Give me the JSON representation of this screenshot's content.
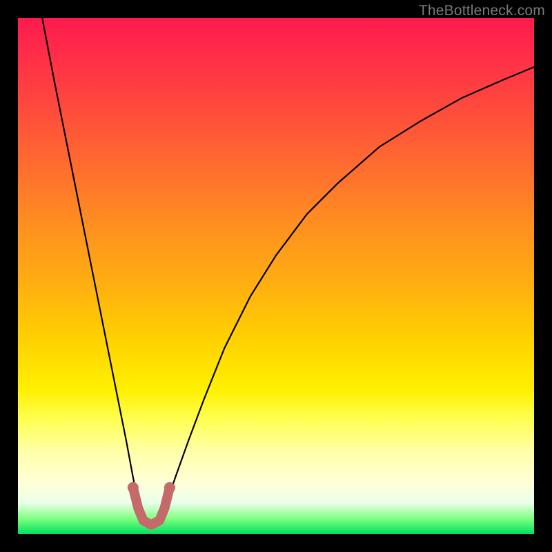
{
  "watermark": "TheBottleneck.com",
  "colors": {
    "bg_outer": "#000000",
    "gradient_top": "#ff1a4d",
    "gradient_bottom": "#00e060",
    "curve": "#000000",
    "nub": "#c46a6a",
    "watermark": "#7a7a7a"
  },
  "chart_data": {
    "type": "line",
    "title": "",
    "xlabel": "",
    "ylabel": "",
    "xlim": [
      0,
      100
    ],
    "ylim": [
      0,
      100
    ],
    "grid": false,
    "legend": false,
    "series": [
      {
        "name": "left-branch",
        "x": [
          4.7,
          7,
          9,
          11,
          13,
          15,
          17,
          19,
          21,
          22.3,
          23.3,
          24.3
        ],
        "y": [
          100,
          88,
          78,
          68,
          58,
          48,
          38,
          28,
          18,
          11,
          6,
          2.6
        ]
      },
      {
        "name": "right-branch",
        "x": [
          27.4,
          28.8,
          30.5,
          33,
          36,
          40,
          45,
          50,
          56,
          62,
          70,
          78,
          86,
          94,
          100
        ],
        "y": [
          2.6,
          6,
          11,
          18,
          26,
          36,
          46,
          54,
          62,
          68,
          75,
          80,
          84.5,
          88,
          90.5
        ]
      },
      {
        "name": "valley-u",
        "x": [
          22.3,
          23.3,
          24.3,
          25.8,
          27.4,
          28.4,
          29.4
        ],
        "y": [
          9,
          5,
          2.6,
          1.8,
          2.6,
          5,
          9
        ]
      }
    ],
    "annotations": [
      {
        "text": "TheBottleneck.com",
        "position": "top-right"
      }
    ]
  }
}
